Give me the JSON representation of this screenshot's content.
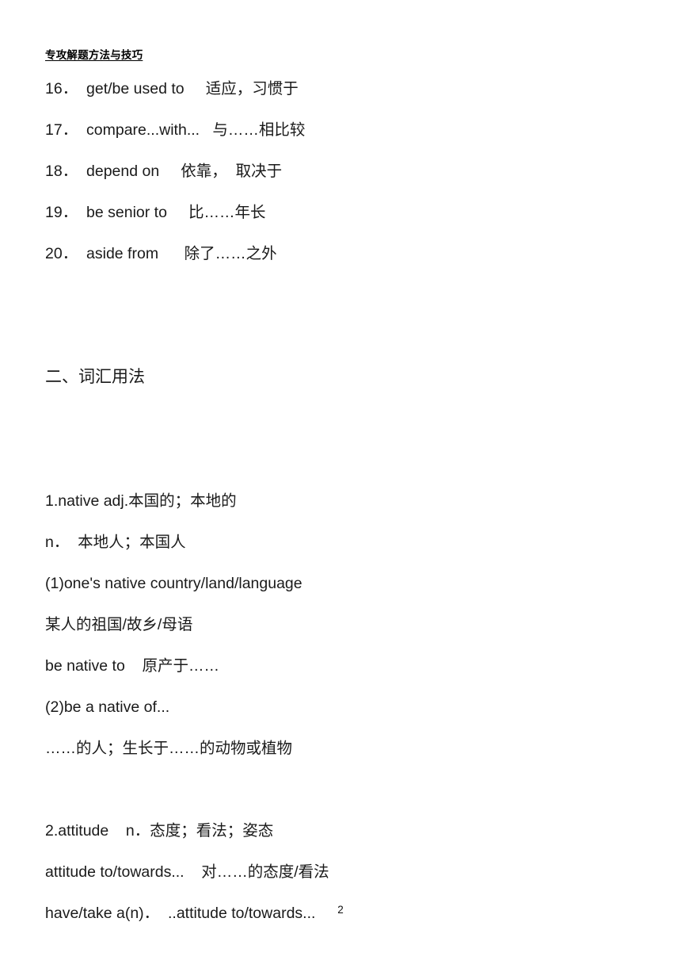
{
  "document": {
    "header": "专攻解题方法与技巧",
    "page_number": "2"
  },
  "phrase_list": {
    "items": [
      {
        "index": "16．",
        "english": "get/be used to",
        "chinese": "适应，习惯于"
      },
      {
        "index": "17．",
        "english": "compare...with...",
        "chinese": "与……相比较"
      },
      {
        "index": "18．",
        "english": "depend on",
        "chinese": "依靠，  取决于"
      },
      {
        "index": "19．",
        "english": "be senior to",
        "chinese": "比……年长"
      },
      {
        "index": "20．",
        "english": "aside from",
        "chinese": "除了……之外"
      }
    ],
    "lines": [
      "16．  get/be used to     适应，习惯于",
      "17．  compare...with...   与……相比较",
      "18．  depend on     依靠，  取决于",
      "19．  be senior to     比……年长",
      "20．  aside from      除了……之外"
    ]
  },
  "section_two": {
    "title": "二、词汇用法",
    "entries": [
      {
        "headword": "1.native",
        "lines": [
          "1.native adj.本国的；本地的",
          "n．  本地人；本国人",
          "(1)one's native country/land/language",
          "某人的祖国/故乡/母语",
          "be native to    原产于……",
          "(2)be a native of...",
          "……的人；生长于……的动物或植物"
        ]
      },
      {
        "headword": "2.attitude",
        "lines": [
          "2.attitude    n．态度；看法；姿态",
          "attitude to/towards...    对……的态度/看法",
          "have/take a(n)．  ..attitude to/towards..."
        ]
      }
    ]
  }
}
